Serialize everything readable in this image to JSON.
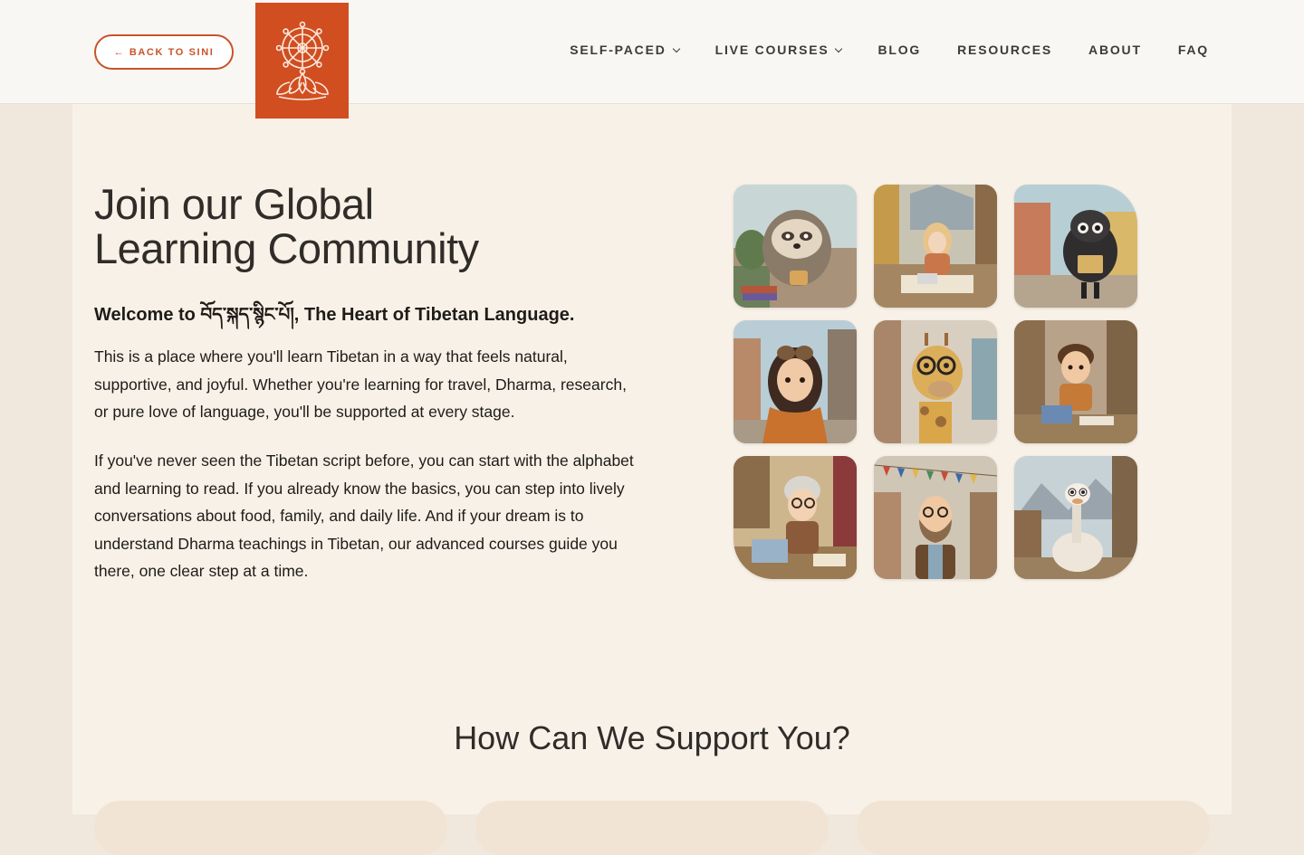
{
  "header": {
    "back_label": "← BACK TO SINI",
    "logo": "dharma-wheel-lotus-logo",
    "nav": [
      {
        "label": "SELF-PACED",
        "dropdown": true
      },
      {
        "label": "LIVE COURSES",
        "dropdown": true
      },
      {
        "label": "BLOG",
        "dropdown": false
      },
      {
        "label": "RESOURCES",
        "dropdown": false
      },
      {
        "label": "ABOUT",
        "dropdown": false
      },
      {
        "label": "FAQ",
        "dropdown": false
      }
    ]
  },
  "hero": {
    "title_line1": "Join our Global",
    "title_line2": "Learning Community",
    "subtitle": "Welcome to བོད་སྐད་སྙིང་པོ།, The Heart of Tibetan Language.",
    "paragraph1": "This is a place where you'll learn Tibetan in a way that feels natural, supportive, and joyful. Whether you're learning for travel, Dharma, research, or pure love of language, you'll be supported at every stage.",
    "paragraph2": "If you've never seen the Tibetan script before, you can start with the alphabet and learning to read. If you already know the basics, you can step into lively conversations about food, family, and daily life. And if your dream is to understand Dharma teachings in Tibetan, our advanced courses guide you there, one clear step at a time."
  },
  "gallery": [
    {
      "subject": "sloth-with-tea"
    },
    {
      "subject": "girl-studying-room"
    },
    {
      "subject": "black-sheep-reading"
    },
    {
      "subject": "girl-with-goggles-street"
    },
    {
      "subject": "giraffe-with-glasses"
    },
    {
      "subject": "boy-with-laptop-library"
    },
    {
      "subject": "grandma-with-laptop"
    },
    {
      "subject": "bearded-man-prayer-flags"
    },
    {
      "subject": "ostrich-in-study"
    }
  ],
  "support": {
    "title": "How Can We Support You?"
  },
  "colors": {
    "accent": "#d14e21",
    "page_bg": "#f1e8dd",
    "panel_bg": "#f8f1e7",
    "header_bg": "#f9f7f4",
    "text": "#2f2c29"
  }
}
